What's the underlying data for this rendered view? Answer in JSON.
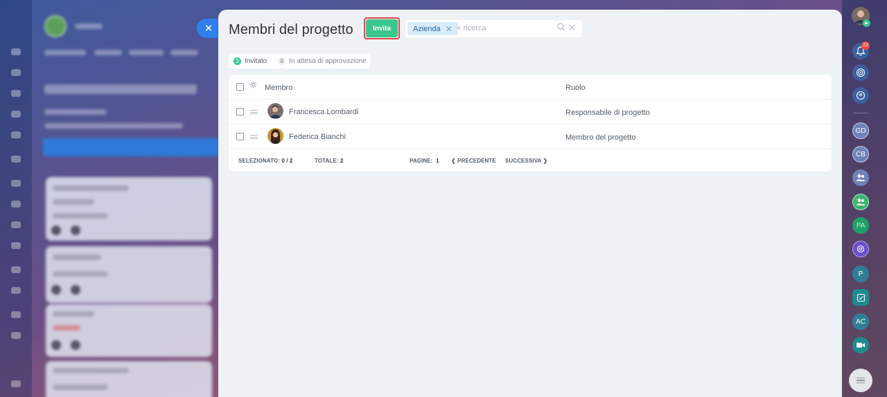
{
  "panel": {
    "title": "Membri del progetto",
    "invite_label": "Invita"
  },
  "search": {
    "tag_label": "Azienda",
    "placeholder": "+ ricerca"
  },
  "filters": {
    "invited_count": "3",
    "invited_label": "Invitato",
    "pending_count": "0",
    "pending_label": "In attesa di approvazione"
  },
  "table": {
    "col_member": "Membro",
    "col_role": "Ruolo",
    "rows": [
      {
        "name": "Francesca Lombardi",
        "role": "Responsabile di progetto"
      },
      {
        "name": "Federica Bianchi",
        "role": "Membro del progetto"
      }
    ]
  },
  "footer": {
    "selected_label": "SELEZIONATO:",
    "selected_value": "0 / 2",
    "total_label": "TOTALE:",
    "total_value": "2",
    "pages_label": "PAGINE:",
    "pages_value": "1",
    "prev_label": "PRECEDENTE",
    "next_label": "SUCCESSIVA"
  },
  "sidebar": {
    "notification_count": "22",
    "items": [
      "GD",
      "CB",
      "PA",
      "P",
      "AC"
    ]
  },
  "colors": {
    "accent": "#2f80ed",
    "invite_green": "#3bc68b",
    "highlight_red": "#e0454b"
  }
}
